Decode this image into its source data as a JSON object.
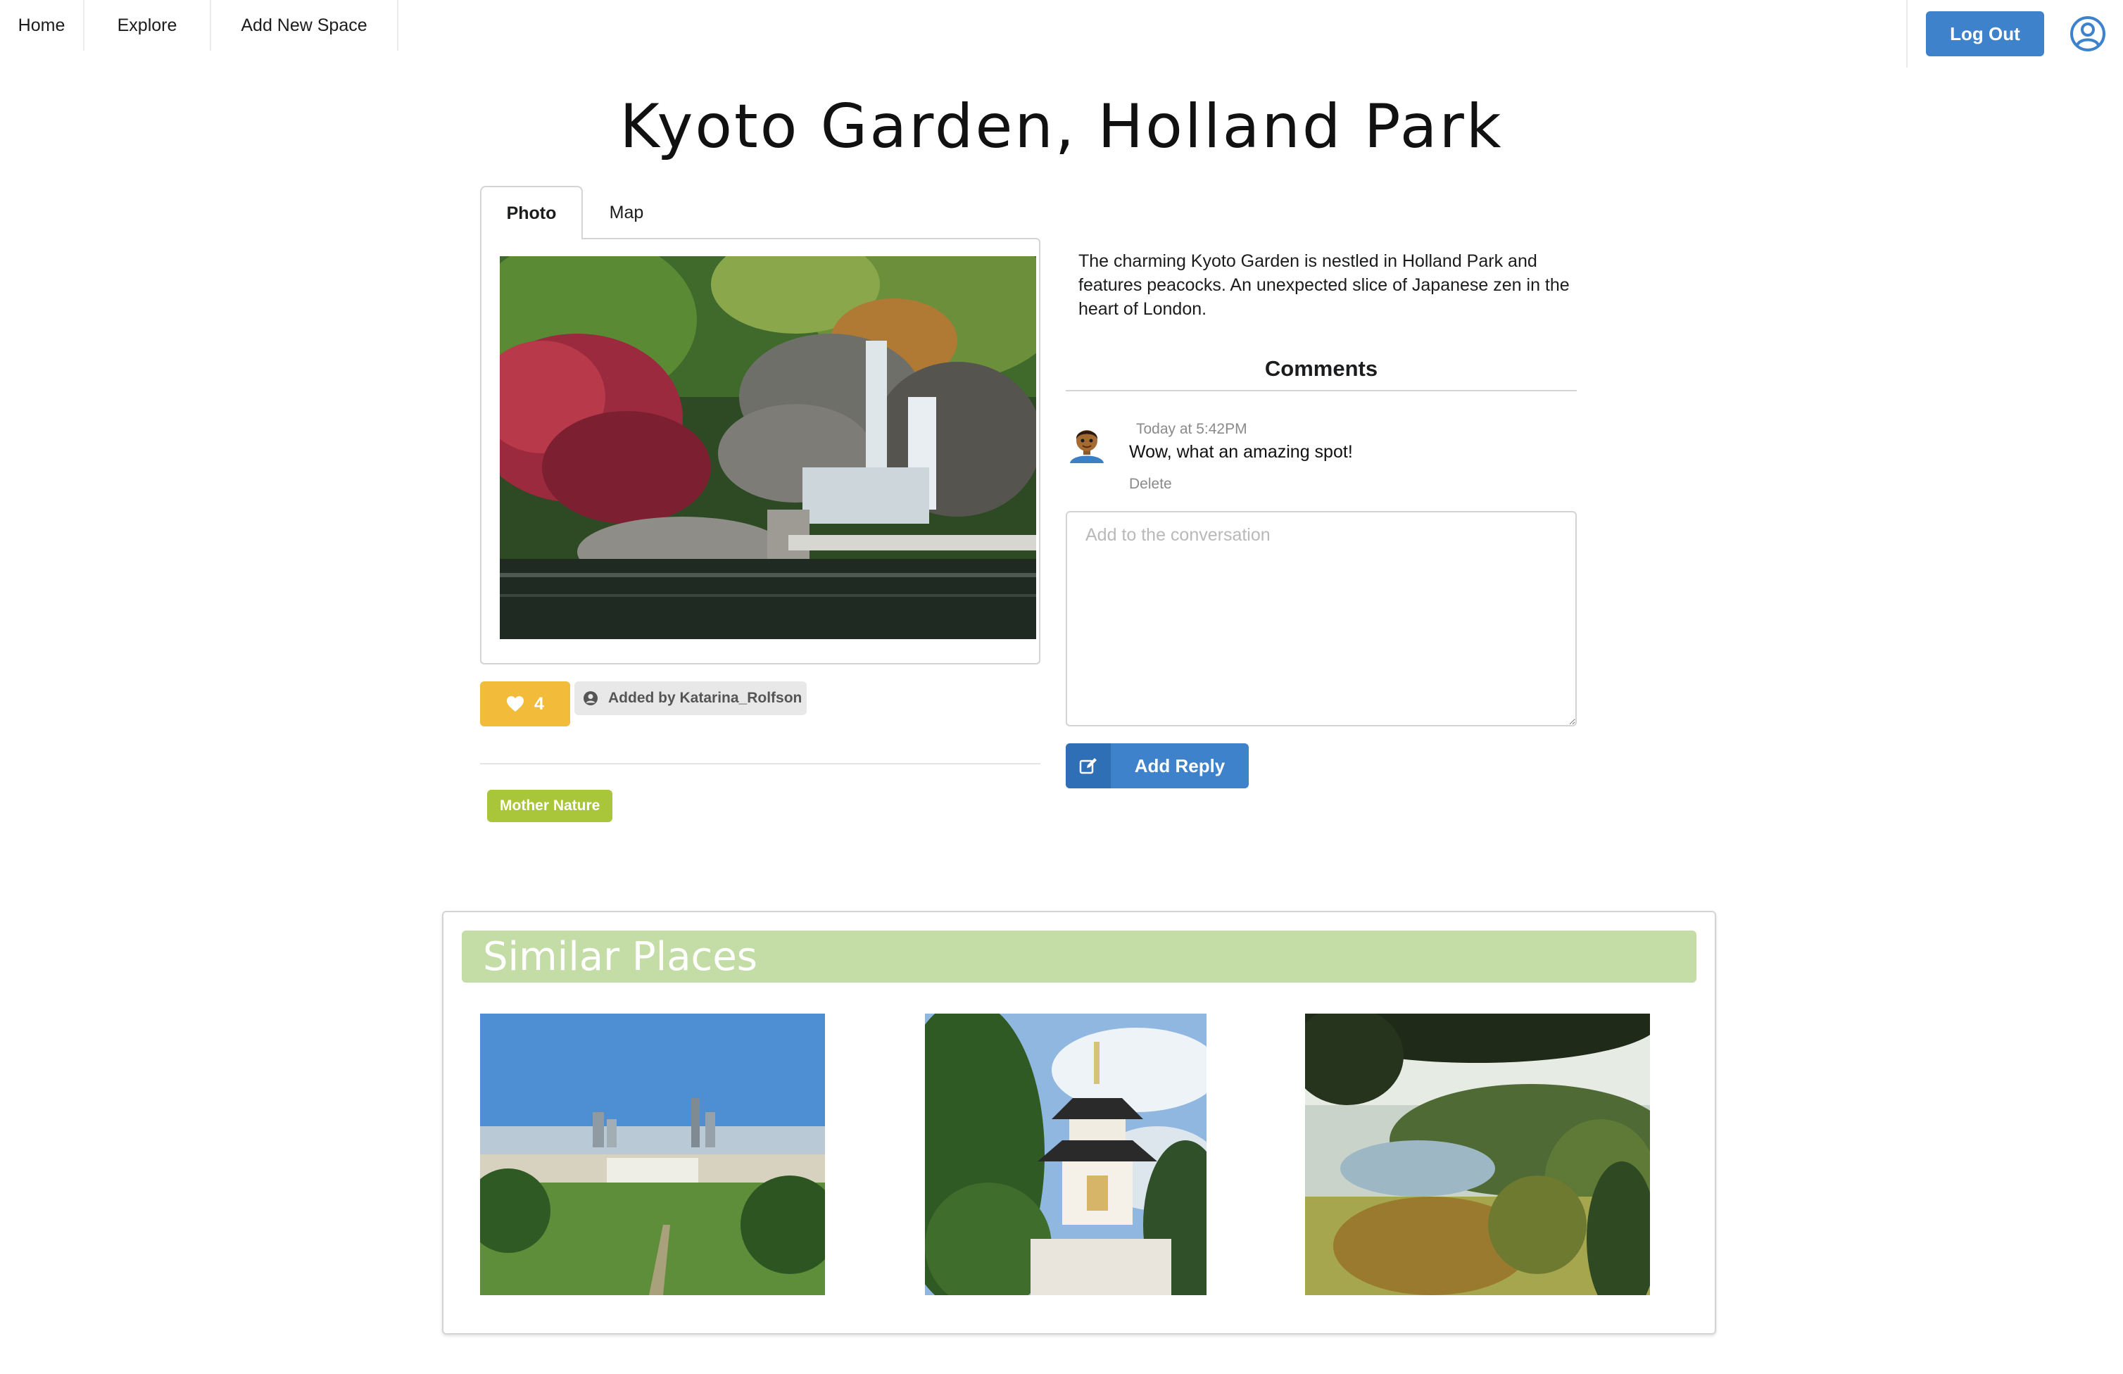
{
  "nav": {
    "home": "Home",
    "explore": "Explore",
    "add_new_space": "Add New Space",
    "logout": "Log Out"
  },
  "page": {
    "title": "Kyoto Garden, Holland Park"
  },
  "tabs": [
    {
      "label": "Photo",
      "active": true
    },
    {
      "label": "Map",
      "active": false
    }
  ],
  "place": {
    "description": "The charming Kyoto Garden is nestled in Holland Park and features peacocks. An unexpected slice of Japanese zen in the heart of London.",
    "likes": "4",
    "added_by": "Added by Katarina_Rolfson",
    "tag": "Mother Nature"
  },
  "comments": {
    "header": "Comments",
    "items": [
      {
        "time": "Today at 5:42PM",
        "text": "Wow, what an amazing spot!",
        "delete_label": "Delete"
      }
    ],
    "reply_placeholder": "Add to the conversation",
    "reply_button": "Add Reply"
  },
  "similar": {
    "header": "Similar Places"
  },
  "colors": {
    "primary": "#3d82cb",
    "like": "#f2bb39",
    "tag": "#a9c53a",
    "similar_header": "#c4dca6"
  }
}
